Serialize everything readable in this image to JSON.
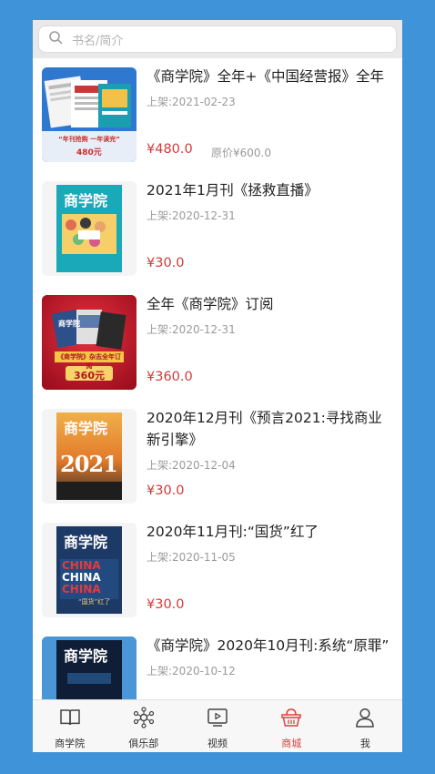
{
  "search": {
    "placeholder": "书名/简介"
  },
  "items": [
    {
      "title": "《商学院》全年+《中国经营报》全年",
      "date": "上架:2021-02-23",
      "price": "¥480.0",
      "original_price": "原价¥600.0",
      "cover": {
        "price_tag": "480元",
        "banner": "“年刊抢购 一年读完”"
      }
    },
    {
      "title": "2021年1月刊《拯救直播》",
      "date": "上架:2020-12-31",
      "price": "¥30.0",
      "cover": {
        "masthead": "商学院"
      }
    },
    {
      "title": "全年《商学院》订阅",
      "date": "上架:2020-12-31",
      "price": "¥360.0",
      "cover": {
        "banner": "《商学院》杂志全年订阅",
        "price_tag": "360元",
        "mini": "商学院"
      }
    },
    {
      "title": "2020年12月刊《预言2021:寻找商业新引擎》",
      "date": "上架:2020-12-04",
      "price": "¥30.0",
      "cover": {
        "masthead": "商学院",
        "big": "2021"
      }
    },
    {
      "title": "2020年11月刊:“国货”红了",
      "date": "上架:2020-11-05",
      "price": "¥30.0",
      "cover": {
        "masthead": "商学院",
        "word": "CHINA",
        "caption": "“国货”红了"
      }
    },
    {
      "title": "《商学院》2020年10月刊:系统“原罪”",
      "date": "上架:2020-10-12",
      "price": "",
      "cover": {
        "masthead": "商学院"
      }
    }
  ],
  "tabbar": [
    {
      "label": "商学院",
      "icon": "book-icon"
    },
    {
      "label": "俱乐部",
      "icon": "club-icon"
    },
    {
      "label": "视频",
      "icon": "video-icon"
    },
    {
      "label": "商城",
      "icon": "basket-icon",
      "active": true
    },
    {
      "label": "我",
      "icon": "person-icon"
    }
  ],
  "colors": {
    "accent": "#d9433f",
    "price": "#d23a3a",
    "background": "#3f93d8"
  }
}
